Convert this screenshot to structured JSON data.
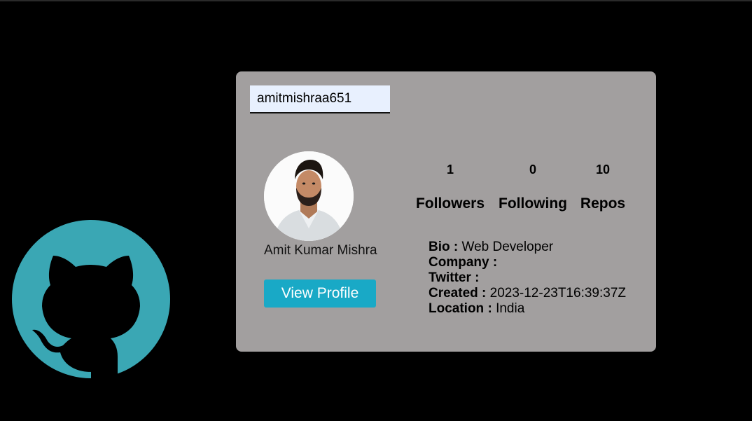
{
  "search": {
    "value": "amitmishraa651"
  },
  "profile": {
    "name": "Amit Kumar Mishra",
    "view_profile_label": "View Profile"
  },
  "stats": [
    {
      "count": "1",
      "label": "Followers"
    },
    {
      "count": "0",
      "label": "Following"
    },
    {
      "count": "10",
      "label": "Repos"
    }
  ],
  "info": {
    "bio_label": "Bio :",
    "bio_value": "Web Developer",
    "company_label": "Company :",
    "company_value": "",
    "twitter_label": "Twitter :",
    "twitter_value": "",
    "created_label": "Created :",
    "created_value": "2023-12-23T16:39:37Z",
    "location_label": "Location :",
    "location_value": "India"
  },
  "colors": {
    "background": "#000000",
    "card": "#a29f9f",
    "button": "#19a9c6",
    "logo": "#3aa7b4",
    "input": "#e8f0fe"
  },
  "icons": {
    "logo": "github-octocat-icon"
  }
}
